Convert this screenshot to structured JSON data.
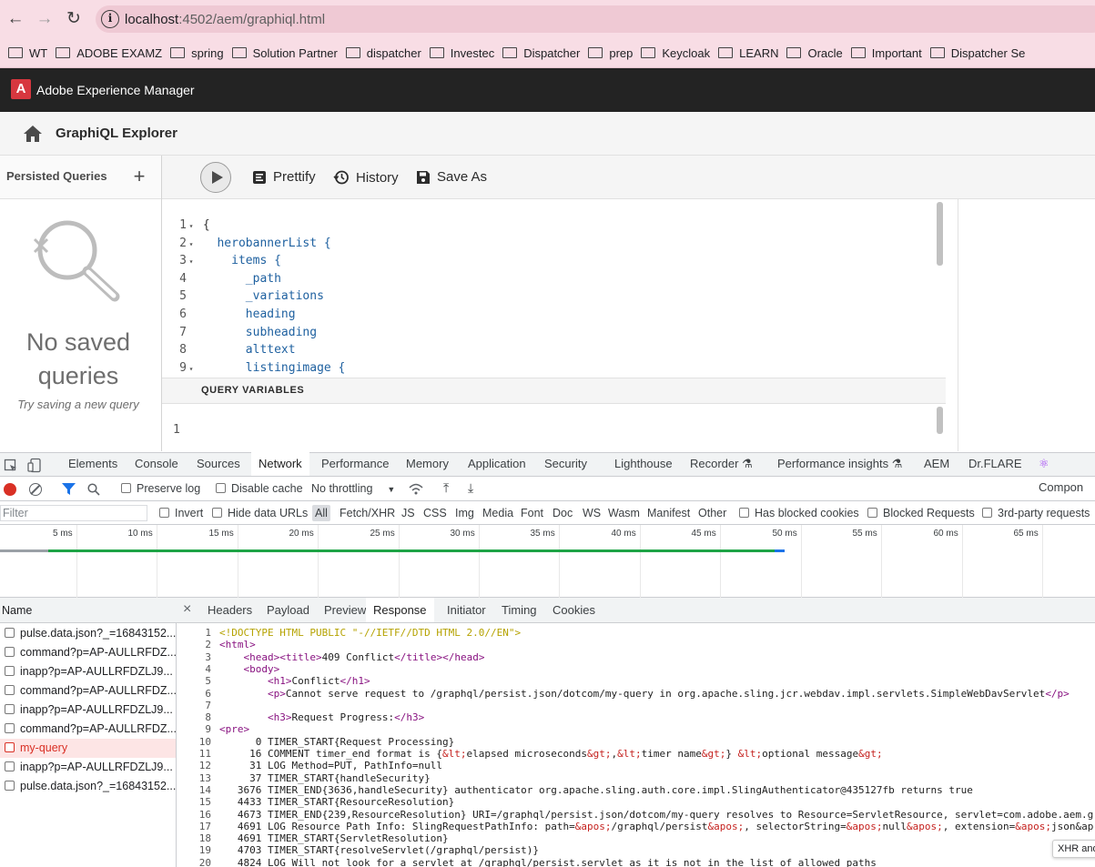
{
  "browser": {
    "url_host": "localhost",
    "url_rest": ":4502/aem/graphiql.html",
    "bookmarks": [
      "WT",
      "ADOBE EXAMZ",
      "spring",
      "Solution Partner",
      "dispatcher",
      "Investec",
      "Dispatcher",
      "prep",
      "Keycloak",
      "LEARN",
      "Oracle",
      "Important",
      "Dispatcher Se"
    ]
  },
  "aem": {
    "logo_letter": "A",
    "title": "Adobe Experience Manager",
    "page_title": "GraphiQL Explorer"
  },
  "persisted": {
    "title": "Persisted Queries",
    "add": "+",
    "empty_line1": "No saved",
    "empty_line2": "queries",
    "hint": "Try saving a new query"
  },
  "toolbar": {
    "prettify": "Prettify",
    "history": "History",
    "save_as": "Save As"
  },
  "editor": {
    "lines": [
      {
        "n": "1",
        "fold": "▾",
        "text": "{",
        "kind": "br",
        "indent": ""
      },
      {
        "n": "2",
        "fold": "▾",
        "text": "herobannerList {",
        "kind": "tx",
        "indent": "  "
      },
      {
        "n": "3",
        "fold": "▾",
        "text": "items {",
        "kind": "tx",
        "indent": "    "
      },
      {
        "n": "4",
        "fold": "",
        "text": "_path",
        "kind": "tx",
        "indent": "      "
      },
      {
        "n": "5",
        "fold": "",
        "text": "_variations",
        "kind": "tx",
        "indent": "      "
      },
      {
        "n": "6",
        "fold": "",
        "text": "heading",
        "kind": "tx",
        "indent": "      "
      },
      {
        "n": "7",
        "fold": "",
        "text": "subheading",
        "kind": "tx",
        "indent": "      "
      },
      {
        "n": "8",
        "fold": "",
        "text": "alttext",
        "kind": "tx",
        "indent": "      "
      },
      {
        "n": "9",
        "fold": "▾",
        "text": "listingimage {",
        "kind": "tx",
        "indent": "      "
      }
    ],
    "query_variables": "QUERY VARIABLES",
    "qv_line": "1"
  },
  "devtools": {
    "tabs": [
      "Elements",
      "Console",
      "Sources",
      "Network",
      "Performance",
      "Memory",
      "Application",
      "Security",
      "Lighthouse",
      "Recorder ⚗",
      "Performance insights ⚗",
      "AEM",
      "Dr.FLARE",
      "Compon"
    ],
    "active_tab": "Network",
    "preserve_log": "Preserve log",
    "disable_cache": "Disable cache",
    "throttling": "No throttling",
    "filter_placeholder": "Filter",
    "invert": "Invert",
    "hide_data_urls": "Hide data URLs",
    "types": [
      "All",
      "Fetch/XHR",
      "JS",
      "CSS",
      "Img",
      "Media",
      "Font",
      "Doc",
      "WS",
      "Wasm",
      "Manifest",
      "Other"
    ],
    "has_blocked": "Has blocked cookies",
    "blocked_requests": "Blocked Requests",
    "third_party": "3rd-party requests",
    "timeline_labels": [
      "5 ms",
      "10 ms",
      "15 ms",
      "20 ms",
      "25 ms",
      "30 ms",
      "35 ms",
      "40 ms",
      "45 ms",
      "50 ms",
      "55 ms",
      "60 ms",
      "65 ms"
    ],
    "name_header": "Name",
    "requests": [
      "pulse.data.json?_=16843152...",
      "command?p=AP-AULLRFDZ...",
      "inapp?p=AP-AULLRFDZLJ9...",
      "command?p=AP-AULLRFDZ...",
      "inapp?p=AP-AULLRFDZLJ9...",
      "command?p=AP-AULLRFDZ...",
      "my-query",
      "inapp?p=AP-AULLRFDZLJ9...",
      "pulse.data.json?_=16843152..."
    ],
    "selected_request": "my-query",
    "detail_tabs": [
      "Headers",
      "Payload",
      "Preview",
      "Response",
      "Initiator",
      "Timing",
      "Cookies"
    ],
    "active_detail_tab": "Response",
    "close": "×",
    "xhr_tooltip": "XHR and"
  },
  "response_lines": [
    "<!DOCTYPE HTML PUBLIC \"-//IETF//DTD HTML 2.0//EN\">",
    "<html>",
    "    <head><title>409 Conflict</title></head>",
    "    <body>",
    "        <h1>Conflict</h1>",
    "        <p>Cannot serve request to /graphql/persist.json/dotcom/my-query in org.apache.sling.jcr.webdav.impl.servlets.SimpleWebDavServlet</p>",
    "",
    "        <h3>Request Progress:</h3>",
    "<pre>",
    "      0 TIMER_START{Request Processing}",
    "     16 COMMENT timer_end format is {&lt;elapsed microseconds&gt;,&lt;timer name&gt;} &lt;optional message&gt;",
    "     31 LOG Method=PUT, PathInfo=null",
    "     37 TIMER_START{handleSecurity}",
    "   3676 TIMER_END{3636,handleSecurity} authenticator org.apache.sling.auth.core.impl.SlingAuthenticator@435127fb returns true",
    "   4433 TIMER_START{ResourceResolution}",
    "   4673 TIMER_END{239,ResourceResolution} URI=/graphql/persist.json/dotcom/my-query resolves to Resource=ServletResource, servlet=com.adobe.aem.g",
    "   4691 LOG Resource Path Info: SlingRequestPathInfo: path=&apos;/graphql/persist&apos;, selectorString=&apos;null&apos;, extension=&apos;json&ap",
    "   4691 TIMER_START{ServletResolution}",
    "   4703 TIMER_START{resolveServlet(/graphql/persist)}",
    "   4824 LOG Will not look for a servlet at /graphql/persist.servlet as it is not in the list of allowed paths"
  ]
}
